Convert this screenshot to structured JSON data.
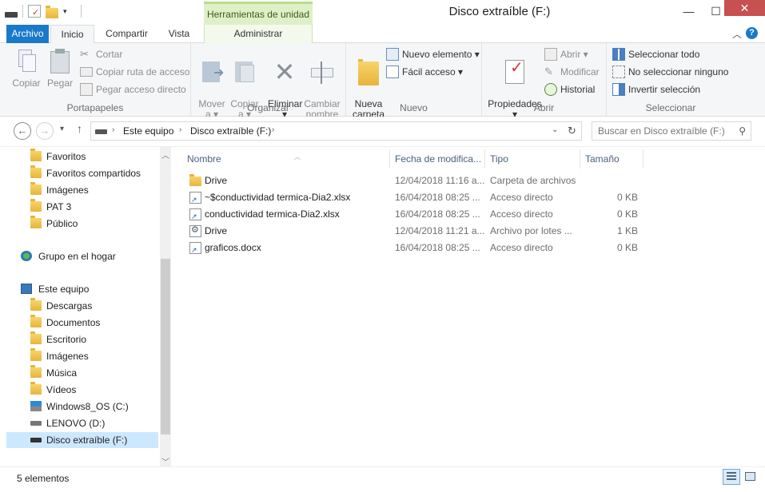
{
  "window": {
    "title": "Disco extraíble (F:)",
    "context_tab_header": "Herramientas de unidad",
    "controls": {
      "minimize": "—",
      "maximize": "☐",
      "close": "✕"
    }
  },
  "tabs": {
    "file": "Archivo",
    "home": "Inicio",
    "share": "Compartir",
    "view": "Vista",
    "manage": "Administrar"
  },
  "ribbon": {
    "clipboard": {
      "label": "Portapapeles",
      "copy": "Copiar",
      "paste": "Pegar",
      "cut": "Cortar",
      "copy_path": "Copiar ruta de acceso",
      "paste_shortcut": "Pegar acceso directo"
    },
    "organize": {
      "label": "Organizar",
      "move_to": "Mover\na ▾",
      "copy_to": "Copiar\na ▾",
      "delete": "Eliminar\n▾",
      "rename": "Cambiar\nnombre"
    },
    "new": {
      "label": "Nuevo",
      "new_folder": "Nueva\ncarpeta",
      "new_item": "Nuevo elemento ▾",
      "easy_access": "Fácil acceso ▾"
    },
    "open": {
      "label": "Abrir",
      "properties": "Propiedades\n▾",
      "open": "Abrir ▾",
      "edit": "Modificar",
      "history": "Historial"
    },
    "select": {
      "label": "Seleccionar",
      "select_all": "Seleccionar todo",
      "select_none": "No seleccionar ninguno",
      "invert": "Invertir selección"
    }
  },
  "address": {
    "crumbs": [
      "Este equipo",
      "Disco extraíble (F:)"
    ],
    "search_placeholder": "Buscar en Disco extraíble (F:)"
  },
  "nav": {
    "favorites": [
      "Favoritos",
      "Favoritos compartidos",
      "Imágenes",
      "PAT 3",
      "Público"
    ],
    "homegroup": "Grupo en el hogar",
    "this_pc": "Este equipo",
    "pc_items": [
      "Descargas",
      "Documentos",
      "Escritorio",
      "Imágenes",
      "Música",
      "Vídeos",
      "Windows8_OS (C:)",
      "LENOVO (D:)",
      "Disco extraíble (F:)"
    ]
  },
  "columns": {
    "name": "Nombre",
    "date": "Fecha de modifica...",
    "type": "Tipo",
    "size": "Tamaño"
  },
  "files": [
    {
      "name": "Drive",
      "date": "12/04/2018 11:16 a...",
      "type": "Carpeta de archivos",
      "size": "",
      "icon": "folder-icon"
    },
    {
      "name": "~$conductividad termica-Dia2.xlsx",
      "date": "16/04/2018 08:25 ...",
      "type": "Acceso directo",
      "size": "0 KB",
      "icon": "shortcut-icon"
    },
    {
      "name": "conductividad termica-Dia2.xlsx",
      "date": "16/04/2018 08:25 ...",
      "type": "Acceso directo",
      "size": "0 KB",
      "icon": "shortcut-icon"
    },
    {
      "name": "Drive",
      "date": "12/04/2018 11:21 a...",
      "type": "Archivo por lotes ...",
      "size": "1 KB",
      "icon": "batch-file-icon"
    },
    {
      "name": "graficos.docx",
      "date": "16/04/2018 08:25 ...",
      "type": "Acceso directo",
      "size": "0 KB",
      "icon": "shortcut-icon"
    }
  ],
  "status": {
    "count": "5 elementos"
  },
  "colors": {
    "accent": "#1979ca",
    "context_tab": "#dff0c8",
    "selection": "#cce8ff",
    "close": "#c75050"
  }
}
